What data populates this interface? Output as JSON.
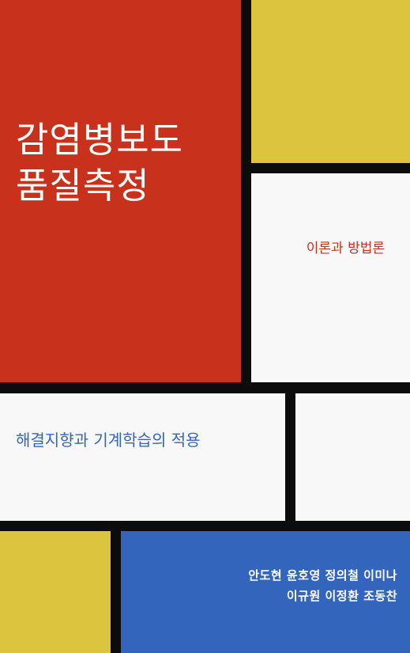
{
  "cover": {
    "title_lines": [
      "감염병보도",
      "품질측정"
    ],
    "subtitle": "이론과 방법론",
    "tagline": "해결지향과 기계학습의 적용",
    "author_lines": [
      "안도현 윤호영 정의철 이미나",
      "이규원 이정환 조동찬"
    ]
  },
  "colors": {
    "red": "#c8311b",
    "yellow": "#dcc43e",
    "blue": "#3465bd",
    "white": "#f8f8f8",
    "grid_lines": "#0c0c0c"
  }
}
